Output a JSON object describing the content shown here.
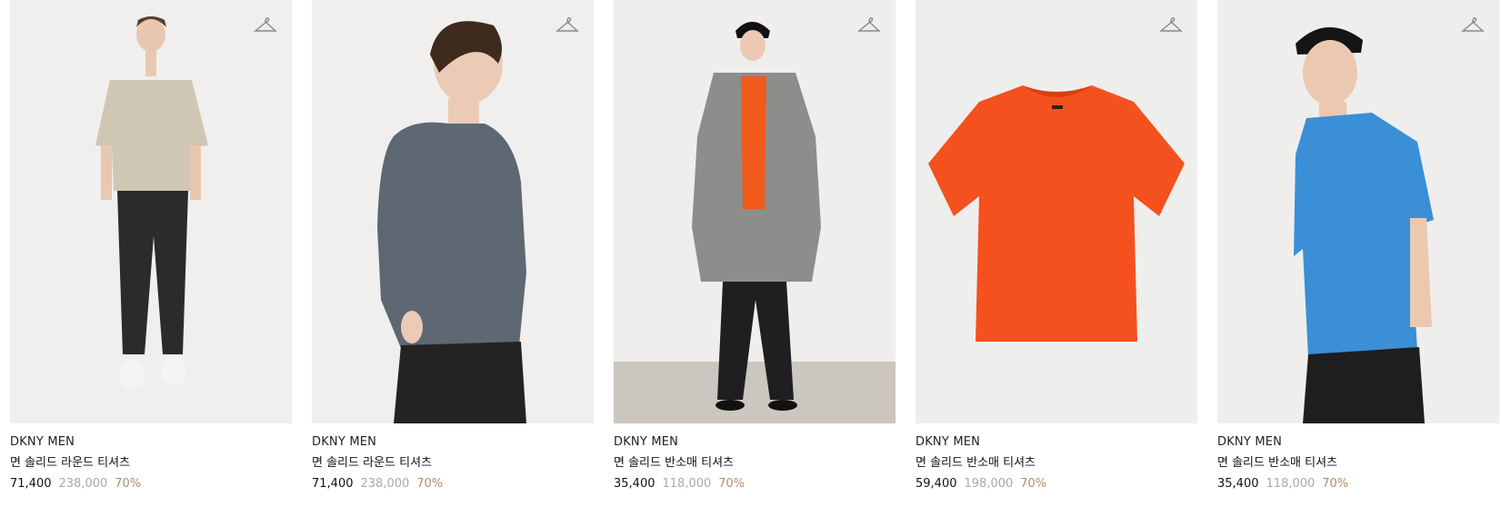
{
  "products": [
    {
      "brand": "DKNY MEN",
      "name": "면 솔리드 라운드 티셔츠",
      "sale_price": "71,400",
      "original_price": "238,000",
      "discount": "70%",
      "color": "#cfc6b4",
      "icon": "hanger-icon"
    },
    {
      "brand": "DKNY MEN",
      "name": "면 솔리드 라운드 티셔츠",
      "sale_price": "71,400",
      "original_price": "238,000",
      "discount": "70%",
      "color": "#5d6872",
      "icon": "hanger-icon"
    },
    {
      "brand": "DKNY MEN",
      "name": "면 솔리드 반소매 티셔츠",
      "sale_price": "35,400",
      "original_price": "118,000",
      "discount": "70%",
      "color": "#f25a1c",
      "icon": "hanger-icon"
    },
    {
      "brand": "DKNY MEN",
      "name": "면 솔리드 반소매 티셔츠",
      "sale_price": "59,400",
      "original_price": "198,000",
      "discount": "70%",
      "color": "#f4511e",
      "icon": "hanger-icon"
    },
    {
      "brand": "DKNY MEN",
      "name": "면 솔리드 반소매 티셔츠",
      "sale_price": "35,400",
      "original_price": "118,000",
      "discount": "70%",
      "color": "#3a8fd6",
      "icon": "hanger-icon"
    }
  ],
  "colors": {
    "discount": "#b08d6a",
    "original_price": "#a8a8a8",
    "image_bg": "#efefee"
  }
}
